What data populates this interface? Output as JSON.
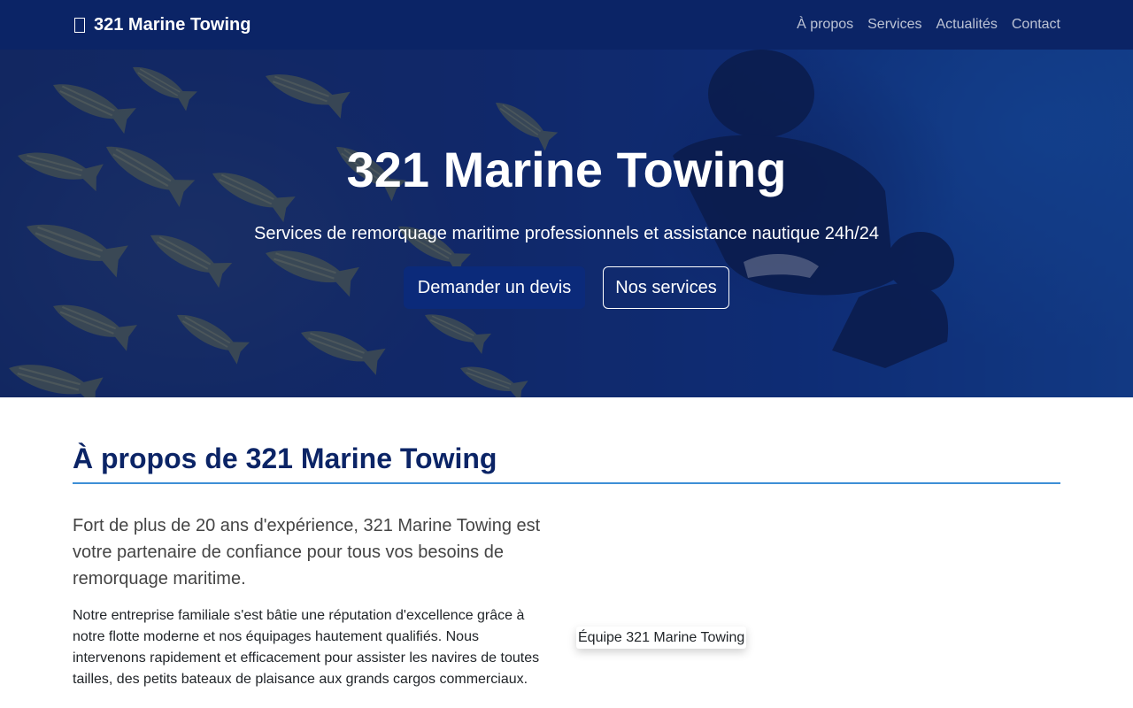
{
  "navbar": {
    "brand": "321 Marine Towing",
    "brand_icon": "anchor-icon",
    "links": [
      "À propos",
      "Services",
      "Actualités",
      "Contact"
    ]
  },
  "hero": {
    "title": "321 Marine Towing",
    "subtitle": "Services de remorquage maritime professionnels et assistance nautique 24h/24",
    "primary_button": "Demander un devis",
    "secondary_button": "Nos services"
  },
  "about": {
    "title": "À propos de 321 Marine Towing",
    "lead": "Fort de plus de 20 ans d'expérience, 321 Marine Towing est votre partenaire de confiance pour tous vos besoins de remorquage maritime.",
    "body": "Notre entreprise familiale s'est bâtie une réputation d'excellence grâce à notre flotte moderne et nos équipages hautement qualifiés. Nous intervenons rapidement et efficacement pour assister les navires de toutes tailles, des petits bateaux de plaisance aux grands cargos commerciaux.",
    "image_alt": "Équipe 321 Marine Towing"
  },
  "colors": {
    "navbar_bg": "#0b2466",
    "primary": "#0b2a7a",
    "heading": "#0b2466",
    "rule": "#3d8fd6"
  }
}
